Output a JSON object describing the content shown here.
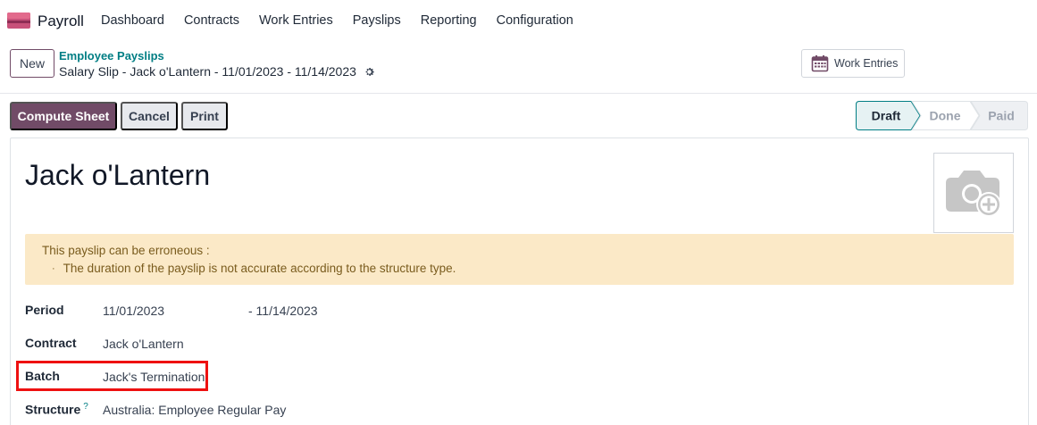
{
  "navbar": {
    "app_name": "Payroll",
    "app_icon": "payroll-app-icon",
    "menu": [
      "Dashboard",
      "Contracts",
      "Work Entries",
      "Payslips",
      "Reporting",
      "Configuration"
    ]
  },
  "control_panel": {
    "new_label": "New",
    "breadcrumb_parent": "Employee Payslips",
    "breadcrumb_current": "Salary Slip - Jack o'Lantern - 11/01/2023 - 11/14/2023",
    "work_entries_label": "Work Entries"
  },
  "actions": {
    "compute_sheet": "Compute Sheet",
    "cancel": "Cancel",
    "print": "Print"
  },
  "status": {
    "steps": [
      "Draft",
      "Done",
      "Paid"
    ],
    "active": "Draft"
  },
  "form": {
    "employee_name": "Jack o'Lantern",
    "alert_title": "This payslip can be erroneous :",
    "alert_item": "The duration of the payslip is not accurate according to the structure type.",
    "alert_bullet": "·",
    "period_label": "Period",
    "period_start": "11/01/2023",
    "period_end": "- 11/14/2023",
    "contract_label": "Contract",
    "contract_value": "Jack o'Lantern",
    "batch_label": "Batch",
    "batch_value": "Jack's Termination",
    "structure_label": "Structure",
    "structure_help": "?",
    "structure_value": "Australia: Employee Regular Pay"
  },
  "colors": {
    "brand": "#714b67",
    "link": "#017e84",
    "alert_bg": "#fbe9c7",
    "highlight": "#ee1111"
  }
}
